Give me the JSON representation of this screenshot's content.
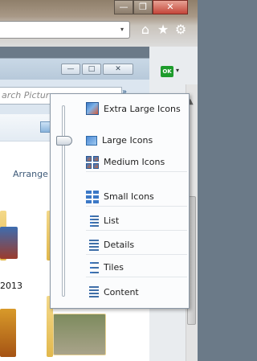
{
  "browser": {
    "window_controls": {
      "minimize": "—",
      "maximize": "❐",
      "close": "✕"
    },
    "address_dropdown": "▾",
    "home_icon": "home-icon",
    "favorites_icon": "star-icon",
    "tools_icon": "gear-icon",
    "addon_badge": "OK",
    "addon_dropdown": "▾",
    "more_chevron": "»"
  },
  "explorer": {
    "title_buttons": {
      "minimize": "—",
      "maximize": "□",
      "close": "✕"
    },
    "search_placeholder": "arch Pictures",
    "arrange_label": "Arrange b",
    "folder_caption": "2013"
  },
  "view_menu": {
    "slider_position": "Large Icons",
    "items": [
      {
        "label": "Extra Large Icons",
        "icon": "extra-large-icons-icon"
      },
      {
        "label": "Large Icons",
        "icon": "large-icons-icon"
      },
      {
        "label": "Medium Icons",
        "icon": "medium-icons-icon"
      },
      {
        "label": "Small Icons",
        "icon": "small-icons-icon"
      },
      {
        "label": "List",
        "icon": "list-icon"
      },
      {
        "label": "Details",
        "icon": "details-icon"
      },
      {
        "label": "Tiles",
        "icon": "tiles-icon"
      },
      {
        "label": "Content",
        "icon": "content-icon"
      }
    ]
  }
}
